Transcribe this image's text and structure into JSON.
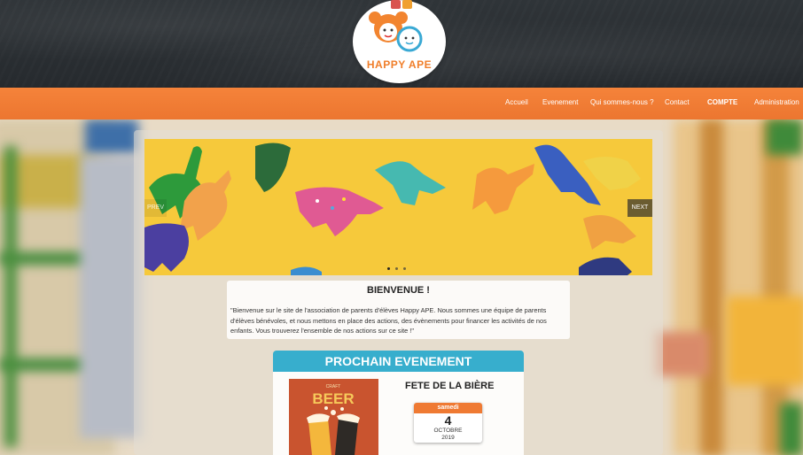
{
  "brand": {
    "logo_text": "HAPPY APE",
    "primary_color": "#ec7630",
    "accent_color": "#37aecd"
  },
  "nav": {
    "items": [
      {
        "label": "Accueil"
      },
      {
        "label": "Evenement"
      },
      {
        "label": "Qui sommes-nous ?"
      },
      {
        "label": "Contact"
      },
      {
        "label": "COMPTE"
      },
      {
        "label": "Administration"
      }
    ]
  },
  "carousel": {
    "prev_label": "PREV",
    "next_label": "NEXT",
    "slide_count": 3,
    "active_slide": 1
  },
  "welcome": {
    "title": "BIENVENUE !",
    "text": "\"Bienvenue sur le site de l'association de parents d'élèves Happy APE. Nous sommes une équipe de parents d'élèves bénévoles, et nous mettons en place des actions, des évènements pour financer les activités de nos enfants. Vous trouverez l'ensemble de nos actions sur ce site !\""
  },
  "next_event": {
    "heading": "PROCHAIN EVENEMENT",
    "title": "FETE DE LA BIÈRE",
    "poster_small": "CRAFT",
    "poster_big": "BEER",
    "date": {
      "weekday": "samedi",
      "day": "4",
      "month": "OCTOBRE",
      "year": "2019"
    }
  }
}
